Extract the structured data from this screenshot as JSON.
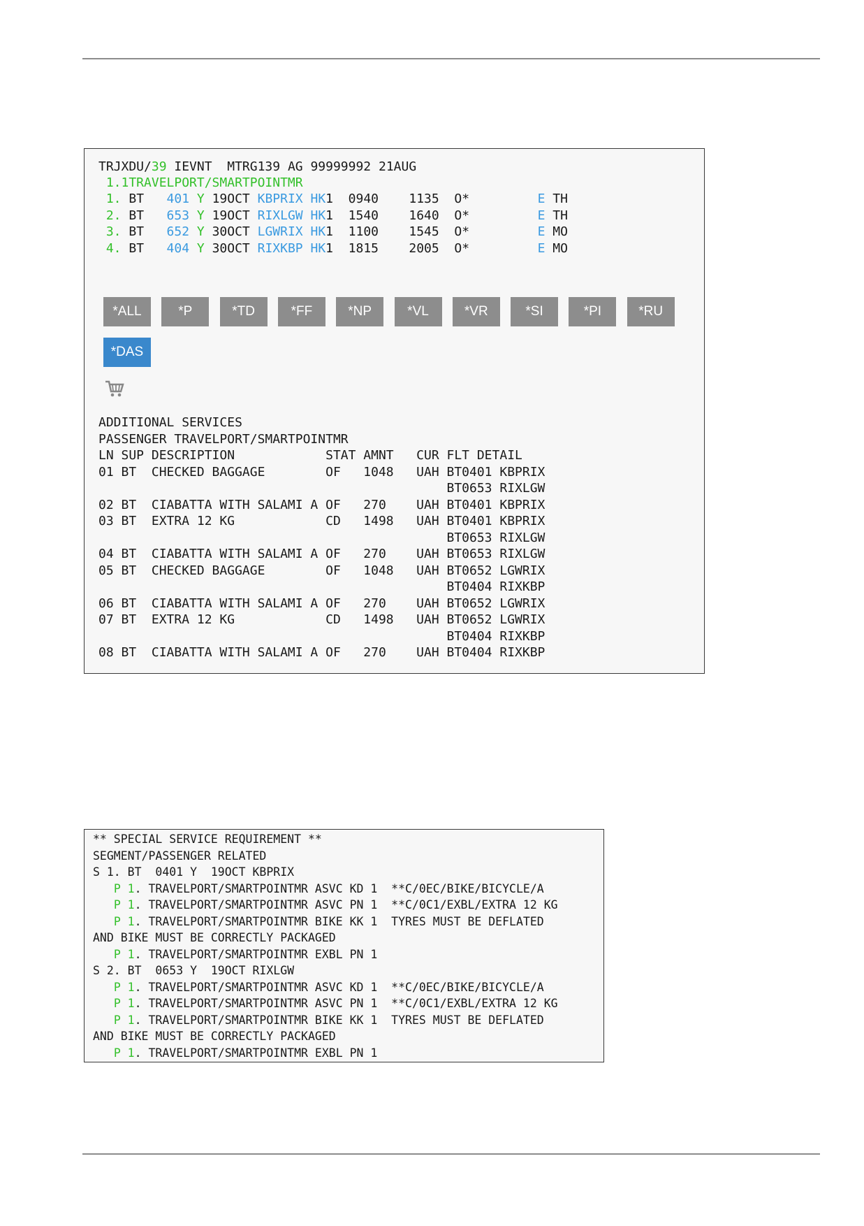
{
  "terminal": {
    "header": {
      "pnr": "TRJXDU/",
      "agent_num": "39",
      "rest": " IEVNT  MTRG139 AG 99999992 21AUG"
    },
    "passenger_line": " 1.1TRAVELPORT/SMARTPOINTMR",
    "segments": [
      {
        "num": " 1.",
        "carrier": " BT  ",
        "flight": " 401",
        "cls": " Y",
        "date": " 19OCT",
        "route": " KBPRIX",
        "status": " HK",
        "qty": "1",
        "times": "  0940    1135  O*",
        "e": "         E",
        "day": " TH"
      },
      {
        "num": " 2.",
        "carrier": " BT  ",
        "flight": " 653",
        "cls": " Y",
        "date": " 19OCT",
        "route": " RIXLGW",
        "status": " HK",
        "qty": "1",
        "times": "  1540    1640  O*",
        "e": "         E",
        "day": " TH"
      },
      {
        "num": " 3.",
        "carrier": " BT  ",
        "flight": " 652",
        "cls": " Y",
        "date": " 30OCT",
        "route": " LGWRIX",
        "status": " HK",
        "qty": "1",
        "times": "  1100    1545  O*",
        "e": "         E",
        "day": " MO"
      },
      {
        "num": " 4.",
        "carrier": " BT  ",
        "flight": " 404",
        "cls": " Y",
        "date": " 30OCT",
        "route": " RIXKBP",
        "status": " HK",
        "qty": "1",
        "times": "  1815    2005  O*",
        "e": "         E",
        "day": " MO"
      }
    ],
    "buttons": [
      "*ALL",
      "*P",
      "*TD",
      "*FF",
      "*NP",
      "*VL",
      "*VR",
      "*SI",
      "*PI",
      "*RU"
    ],
    "active_button": "*DAS",
    "cart_icon": "shopping-cart-icon",
    "services_lines": [
      "ADDITIONAL SERVICES",
      "PASSENGER TRAVELPORT/SMARTPOINTMR",
      "LN SUP DESCRIPTION            STAT AMNT   CUR FLT DETAIL",
      "01 BT  CHECKED BAGGAGE        OF   1048   UAH BT0401 KBPRIX",
      "                                              BT0653 RIXLGW",
      "02 BT  CIABATTA WITH SALAMI A OF   270    UAH BT0401 KBPRIX",
      "03 BT  EXTRA 12 KG            CD   1498   UAH BT0401 KBPRIX",
      "                                              BT0653 RIXLGW",
      "04 BT  CIABATTA WITH SALAMI A OF   270    UAH BT0653 RIXLGW",
      "05 BT  CHECKED BAGGAGE        OF   1048   UAH BT0652 LGWRIX",
      "                                              BT0404 RIXKBP",
      "06 BT  CIABATTA WITH SALAMI A OF   270    UAH BT0652 LGWRIX",
      "07 BT  EXTRA 12 KG            CD   1498   UAH BT0652 LGWRIX",
      "                                              BT0404 RIXKBP",
      "08 BT  CIABATTA WITH SALAMI A OF   270    UAH BT0404 RIXKBP"
    ]
  },
  "ssr": {
    "lines": [
      {
        "text": "** SPECIAL SERVICE REQUIREMENT **"
      },
      {
        "text": "SEGMENT/PASSENGER RELATED"
      },
      {
        "text": "S 1. BT  0401 Y  19OCT KBPRIX"
      },
      {
        "prefix": "   ",
        "p": "P 1",
        "text": ". TRAVELPORT/SMARTPOINTMR ASVC KD 1  **C/0EC/BIKE/BICYCLE/A"
      },
      {
        "prefix": "   ",
        "p": "P 1",
        "text": ". TRAVELPORT/SMARTPOINTMR ASVC PN 1  **C/0C1/EXBL/EXTRA 12 KG"
      },
      {
        "prefix": "   ",
        "p": "P 1",
        "text": ". TRAVELPORT/SMARTPOINTMR BIKE KK 1  TYRES MUST BE DEFLATED"
      },
      {
        "text": "AND BIKE MUST BE CORRECTLY PACKAGED"
      },
      {
        "prefix": "   ",
        "p": "P 1",
        "text": ". TRAVELPORT/SMARTPOINTMR EXBL PN 1"
      },
      {
        "text": "S 2. BT  0653 Y  19OCT RIXLGW"
      },
      {
        "prefix": "   ",
        "p": "P 1",
        "text": ". TRAVELPORT/SMARTPOINTMR ASVC KD 1  **C/0EC/BIKE/BICYCLE/A"
      },
      {
        "prefix": "   ",
        "p": "P 1",
        "text": ". TRAVELPORT/SMARTPOINTMR ASVC PN 1  **C/0C1/EXBL/EXTRA 12 KG"
      },
      {
        "prefix": "   ",
        "p": "P 1",
        "text": ". TRAVELPORT/SMARTPOINTMR BIKE KK 1  TYRES MUST BE DEFLATED"
      },
      {
        "text": "AND BIKE MUST BE CORRECTLY PACKAGED"
      },
      {
        "prefix": "   ",
        "p": "P 1",
        "text": ". TRAVELPORT/SMARTPOINTMR EXBL PN 1"
      }
    ]
  },
  "colors": {
    "green": "#33c02a",
    "blue": "#3a9ae0",
    "button": "#8d8d8d",
    "button_active": "#3a88cc"
  }
}
